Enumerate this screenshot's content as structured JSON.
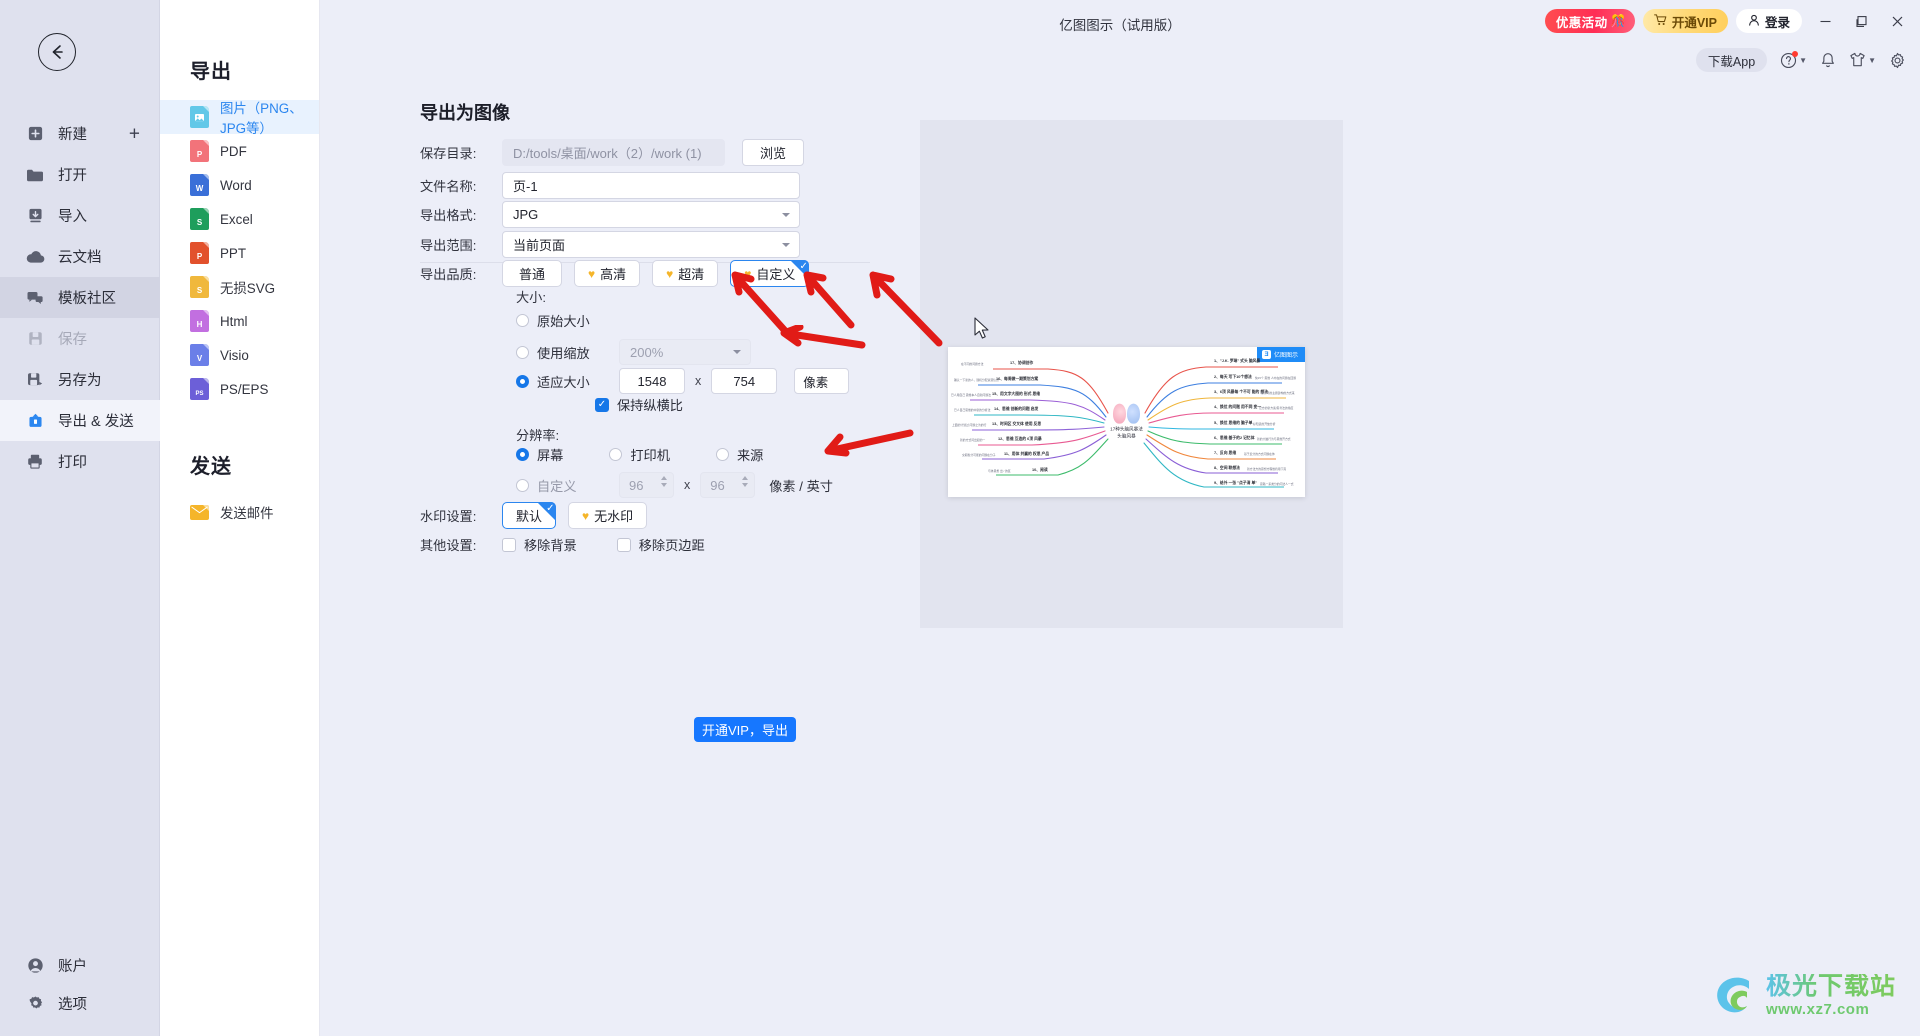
{
  "window": {
    "app_title": "亿图图示（试用版）",
    "promo_label": "优惠活动",
    "vip_label": "开通VIP",
    "login_label": "登录",
    "minimize": "−",
    "maximize": "❐",
    "close": "✕",
    "download_app": "下载App"
  },
  "rail": {
    "items": [
      {
        "label": "新建",
        "icon": "new-file-icon",
        "state": "normal",
        "plus": "+"
      },
      {
        "label": "打开",
        "icon": "folder-icon",
        "state": "normal"
      },
      {
        "label": "导入",
        "icon": "import-icon",
        "state": "normal"
      },
      {
        "label": "云文档",
        "icon": "cloud-icon",
        "state": "normal"
      },
      {
        "label": "模板社区",
        "icon": "community-icon",
        "state": "hover"
      },
      {
        "label": "保存",
        "icon": "save-icon",
        "state": "disabled"
      },
      {
        "label": "另存为",
        "icon": "save-as-icon",
        "state": "normal"
      },
      {
        "label": "导出 & 发送",
        "icon": "export-icon",
        "state": "active"
      },
      {
        "label": "打印",
        "icon": "printer-icon",
        "state": "normal"
      }
    ],
    "bottom_items": [
      {
        "label": "账户",
        "icon": "account-icon"
      },
      {
        "label": "选项",
        "icon": "settings-icon"
      }
    ]
  },
  "nav": {
    "export_heading": "导出",
    "export_items": [
      {
        "label": "图片（PNG、JPG等）",
        "icon": "image-file-icon",
        "color": "#62c8e8",
        "glyph": "",
        "selected": true
      },
      {
        "label": "PDF",
        "icon": "pdf-file-icon",
        "color": "#f2737a",
        "glyph": "P",
        "selected": false
      },
      {
        "label": "Word",
        "icon": "word-file-icon",
        "color": "#3a6fd8",
        "glyph": "W",
        "selected": false
      },
      {
        "label": "Excel",
        "icon": "excel-file-icon",
        "color": "#1e9e5c",
        "glyph": "S",
        "selected": false
      },
      {
        "label": "PPT",
        "icon": "ppt-file-icon",
        "color": "#e2512c",
        "glyph": "P",
        "selected": false
      },
      {
        "label": "无损SVG",
        "icon": "svg-file-icon",
        "color": "#f0b83c",
        "glyph": "S",
        "selected": false
      },
      {
        "label": "Html",
        "icon": "html-file-icon",
        "color": "#c26fe0",
        "glyph": "H",
        "selected": false
      },
      {
        "label": "Visio",
        "icon": "visio-file-icon",
        "color": "#6b7fe8",
        "glyph": "V",
        "selected": false
      },
      {
        "label": "PS/EPS",
        "icon": "ps-file-icon",
        "color": "#6c5fd8",
        "glyph": "PS",
        "selected": false
      }
    ],
    "send_heading": "发送",
    "send_items": [
      {
        "label": "发送邮件",
        "icon": "mail-icon",
        "color": "#f5b52a"
      }
    ]
  },
  "form": {
    "title": "导出为图像",
    "save_dir_label": "保存目录:",
    "save_dir_value": "D:/tools/桌面/work（2）/work (1)",
    "browse_label": "浏览",
    "filename_label": "文件名称:",
    "filename_value": "页-1",
    "format_label": "导出格式:",
    "format_value": "JPG",
    "range_label": "导出范围:",
    "range_value": "当前页面",
    "quality_label": "导出品质:",
    "quality_options": [
      {
        "label": "普通",
        "vip": false,
        "selected": false
      },
      {
        "label": "高清",
        "vip": true,
        "selected": false
      },
      {
        "label": "超清",
        "vip": true,
        "selected": false
      },
      {
        "label": "自定义",
        "vip": true,
        "selected": true
      }
    ],
    "size_label": "大小:",
    "size_original": "原始大小",
    "size_scale": "使用缩放",
    "scale_value": "200%",
    "size_fit": "适应大小",
    "width_value": "1548",
    "height_value": "754",
    "x_sep": "x",
    "unit_value": "像素",
    "keep_ratio": "保持纵横比",
    "keep_ratio_checked": true,
    "resolution_label": "分辨率:",
    "res_options": [
      {
        "label": "屏幕",
        "selected": true
      },
      {
        "label": "打印机",
        "selected": false
      },
      {
        "label": "来源",
        "selected": false
      }
    ],
    "res_custom": "自定义",
    "dpi_x": "96",
    "dpi_y": "96",
    "dpi_unit": "像素 / 英寸",
    "watermark_label": "水印设置:",
    "watermark_options": [
      {
        "label": "默认",
        "vip": false,
        "selected": true
      },
      {
        "label": "无水印",
        "vip": true,
        "selected": false
      }
    ],
    "other_label": "其他设置:",
    "other_options": [
      {
        "label": "移除背景",
        "checked": false
      },
      {
        "label": "移除页边距",
        "checked": false
      }
    ],
    "export_button": "开通VIP，导出"
  },
  "preview": {
    "watermark_text": "亿图图示",
    "center_title_line1": "17种头脑风暴法",
    "center_title_line2": "头脑风暴",
    "left_branches": [
      {
        "title": "17、协调创作",
        "sub": "在不同的问题方法"
      },
      {
        "title": "16、每周做一期策划方案",
        "sub": "确认一下新的人，随机分配资源信息"
      },
      {
        "title": "15、用文字大图的 形式 思维",
        "sub": "已人用自己  思维本人自新问题法"
      },
      {
        "title": "14、思维 创新的问题 启发",
        "sub": "已人自己思维的中新的分析法"
      },
      {
        "title": "13、时间区 交叉体 使用 反思",
        "sub": "上面的计划过 问题之为的行"
      },
      {
        "title": "12、思维 互连的 6顶 风暴",
        "sub": "新的方式问出起的一"
      },
      {
        "title": "11、用体 共赢的 权思 产品",
        "sub": "交期各分可能的问题在分子"
      },
      {
        "title": "10、阅读",
        "sub": "与体思想 出 / 的区"
      }
    ],
    "right_branches": [
      {
        "title": "1、\"J.K. 罗琳\" 式头 脑风暴",
        "sub": ""
      },
      {
        "title": "2、每天 写下10个想法",
        "sub": "快15个 思维 人内在的问题在回题"
      },
      {
        "title": "3、6顶 风暴每 个不可 能的 想法",
        "sub": "基于环的主题建构的方式来"
      },
      {
        "title": "4、换位 的问题 用不同 变一",
        "sub": "记方的新方案/思考法的角度"
      },
      {
        "title": "5、换位 思维的 脑子单",
        "sub": "好知道的开放分析"
      },
      {
        "title": "6、思维 基于的2 记忆体",
        "sub": "新的大脑行为与思维开方式"
      },
      {
        "title": "7、反向 思维",
        "sub": "基于反分的方式问题在体"
      },
      {
        "title": "8、空间 联想法",
        "sub": "新方法方的思想方程维持用下需"
      },
      {
        "title": "9、给外 一张 \"点子清 单\"",
        "sub": "思路一系类分的问法人一式"
      }
    ]
  },
  "footer_watermark": {
    "name": "极光下载站",
    "url": "www.xz7.com"
  }
}
